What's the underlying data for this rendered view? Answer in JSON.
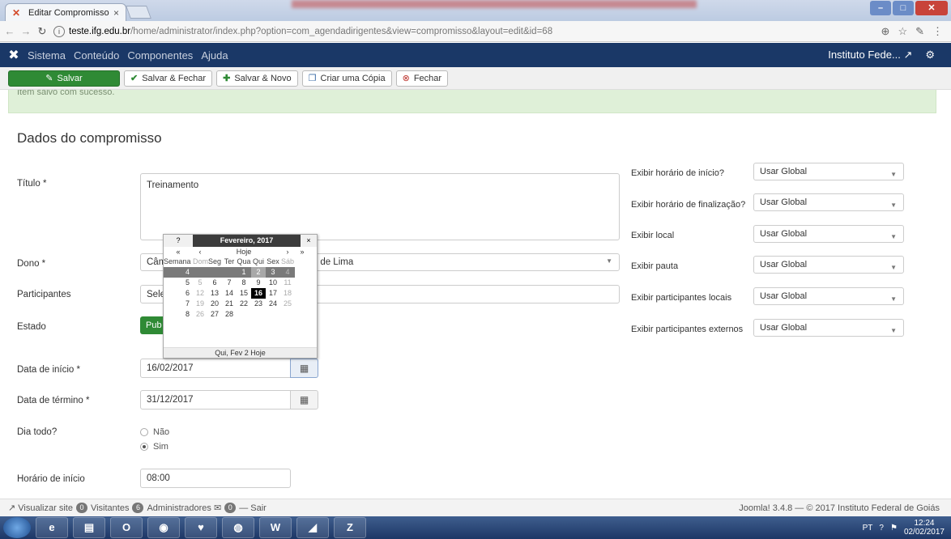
{
  "browser": {
    "tab_title": "Editar Compromisso",
    "tab_close": "×",
    "url_host": "teste.ifg.edu.br",
    "url_path": "/home/administrator/index.php?option=com_agendadirigentes&view=compromisso&layout=edit&id=68"
  },
  "topnav": {
    "menu": [
      "Sistema",
      "Conteúdo",
      "Componentes",
      "Ajuda"
    ],
    "site_name": "Instituto Fede..."
  },
  "toolbar": {
    "save": "Salvar",
    "save_close": "Salvar & Fechar",
    "save_new": "Salvar & Novo",
    "save_copy": "Criar uma Cópia",
    "close": "Fechar"
  },
  "message": "Item salvo com sucesso.",
  "section_title": "Dados do compromisso",
  "form": {
    "titulo_label": "Título *",
    "titulo_value": "Treinamento",
    "dono_label": "Dono *",
    "dono_value_left": "Câm",
    "dono_value_right": "amos de Lima",
    "participantes_label": "Participantes",
    "participantes_value": "Sele",
    "estado_label": "Estado",
    "estado_value": "Pub",
    "data_inicio_label": "Data de início *",
    "data_inicio_value": "16/02/2017",
    "data_termino_label": "Data de término *",
    "data_termino_value": "31/12/2017",
    "dia_todo_label": "Dia todo?",
    "dia_todo_options": [
      "Não",
      "Sim"
    ],
    "horario_inicio_label": "Horário de início",
    "horario_inicio_value": "08:00"
  },
  "right_options": [
    {
      "label": "Exibir horário de início?",
      "value": "Usar Global"
    },
    {
      "label": "Exibir horário de finalização?",
      "value": "Usar Global"
    },
    {
      "label": "Exibir local",
      "value": "Usar Global"
    },
    {
      "label": "Exibir pauta",
      "value": "Usar Global"
    },
    {
      "label": "Exibir participantes locais",
      "value": "Usar Global"
    },
    {
      "label": "Exibir participantes externos",
      "value": "Usar Global"
    }
  ],
  "calendar": {
    "help": "?",
    "title": "Fevereiro, 2017",
    "close": "×",
    "prev_year": "«",
    "prev_month": "‹",
    "today": "Hoje",
    "next_month": "›",
    "next_year": "»",
    "week_header": "Semana",
    "days": [
      "Dom",
      "Seg",
      "Ter",
      "Qua",
      "Qui",
      "Sex",
      "Sáb"
    ],
    "weeks": [
      {
        "wk": "4",
        "d": [
          "",
          "",
          "",
          "1",
          "2",
          "3",
          "4"
        ]
      },
      {
        "wk": "5",
        "d": [
          "5",
          "6",
          "7",
          "8",
          "9",
          "10",
          "11"
        ]
      },
      {
        "wk": "6",
        "d": [
          "12",
          "13",
          "14",
          "15",
          "16",
          "17",
          "18"
        ]
      },
      {
        "wk": "7",
        "d": [
          "19",
          "20",
          "21",
          "22",
          "23",
          "24",
          "25"
        ]
      },
      {
        "wk": "8",
        "d": [
          "26",
          "27",
          "28",
          "",
          "",
          "",
          ""
        ]
      }
    ],
    "footer": "Qui, Fev 2 Hoje"
  },
  "statusbar": {
    "view_site": "Visualizar site",
    "visitors_count": "0",
    "visitors_label": "Visitantes",
    "admins_count": "6",
    "admins_label": "Administradores",
    "messages_count": "0",
    "logout": "Sair",
    "footer_right": "Joomla! 3.4.8 — © 2017 Instituto Federal de Goiás"
  },
  "taskbar": {
    "lang": "PT",
    "time": "12:24",
    "date": "02/02/2017"
  }
}
